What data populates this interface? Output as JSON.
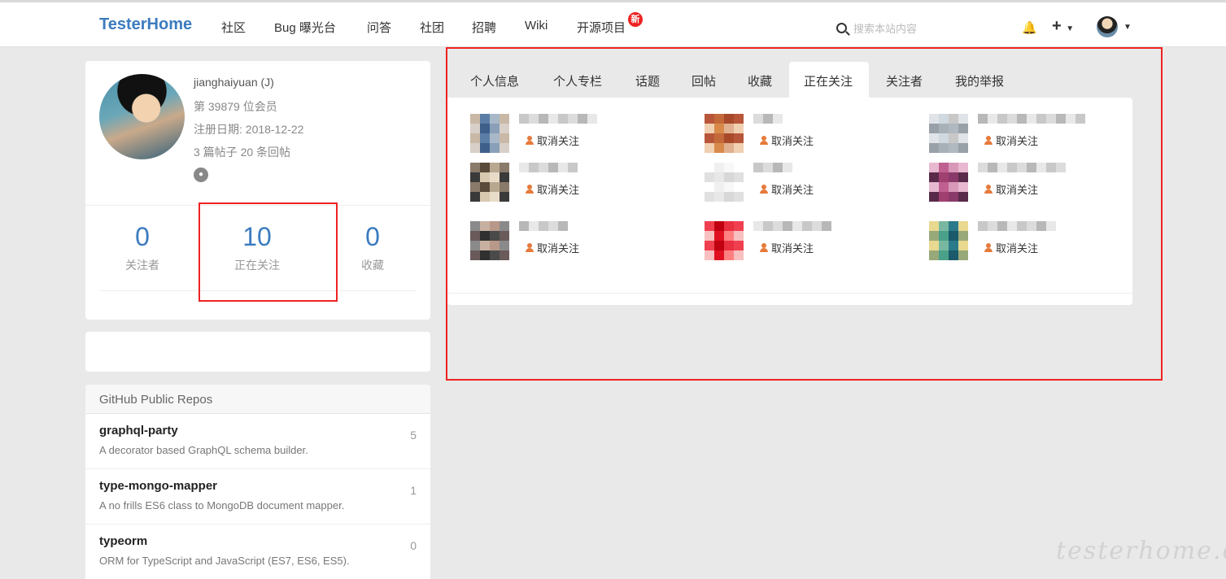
{
  "nav": {
    "brand": "TesterHome",
    "items": [
      "社区",
      "Bug 曝光台",
      "问答",
      "社团",
      "招聘",
      "Wiki",
      "开源项目"
    ],
    "new_badge": "新",
    "search_placeholder": "搜索本站内容"
  },
  "profile": {
    "name": "jianghaiyuan (J)",
    "member_no": "第 39879 位会员",
    "registered": "注册日期: 2018-12-22",
    "posts": "3 篇帖子 20 条回帖",
    "stats": [
      {
        "num": "0",
        "label": "关注者"
      },
      {
        "num": "10",
        "label": "正在关注"
      },
      {
        "num": "0",
        "label": "收藏"
      }
    ]
  },
  "repos": {
    "title": "GitHub Public Repos",
    "items": [
      {
        "name": "graphql-party",
        "desc": "A decorator based GraphQL schema builder.",
        "stars": "5"
      },
      {
        "name": "type-mongo-mapper",
        "desc": "A no frills ES6 class to MongoDB document mapper.",
        "stars": "1"
      },
      {
        "name": "typeorm",
        "desc": "ORM for TypeScript and JavaScript (ES7, ES6, ES5).",
        "stars": "0"
      }
    ]
  },
  "tabs": [
    "个人信息",
    "个人专栏",
    "话题",
    "回帖",
    "收藏",
    "正在关注",
    "关注者",
    "我的举报"
  ],
  "active_tab": "正在关注",
  "following": {
    "unfollow_label": "取消关注",
    "count": 9
  },
  "watermark": "testerhome.com",
  "colors": {
    "brand": "#3b7bbf",
    "highlight": "#ee2222",
    "unfollow_icon": "#e67a3a"
  }
}
